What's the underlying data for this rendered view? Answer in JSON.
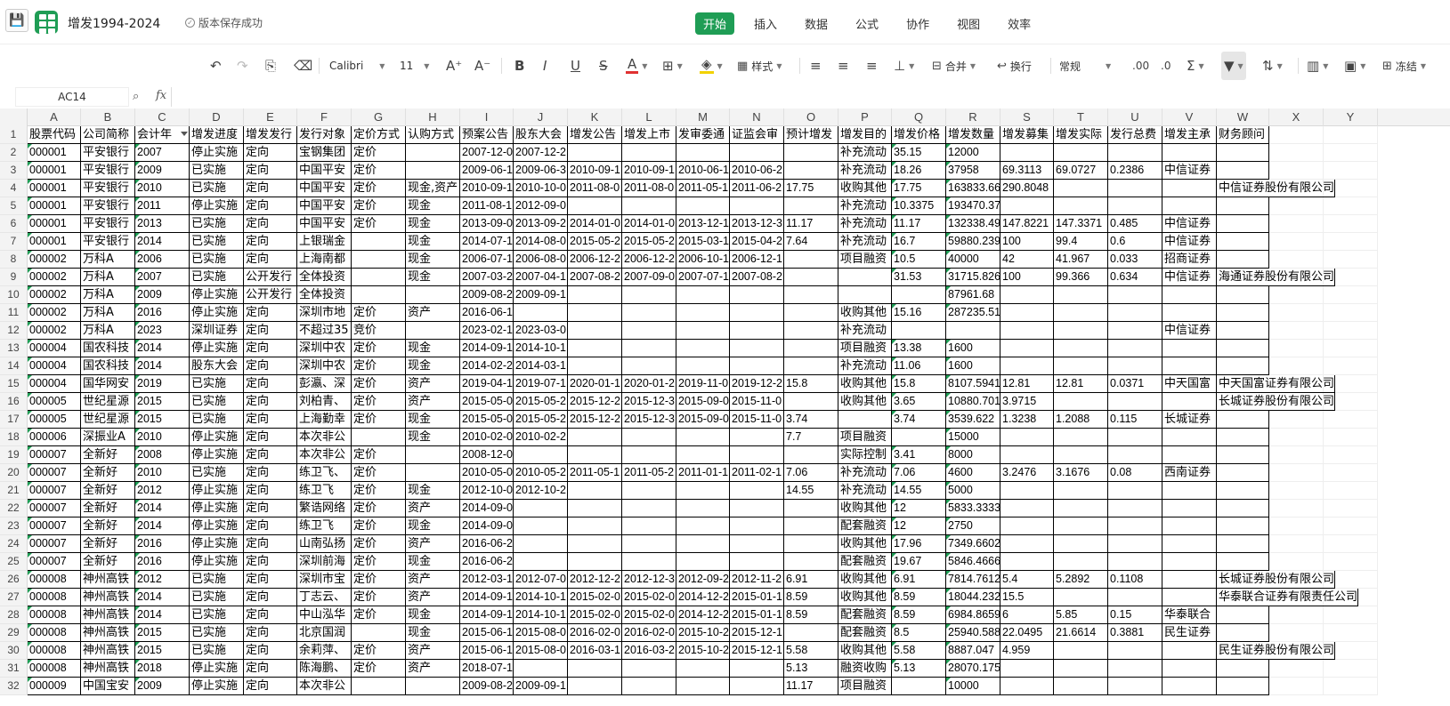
{
  "app": {
    "doc_title": "增发1994-2024",
    "save_status": "版本保存成功",
    "menu_tabs": [
      {
        "label": "开始",
        "active": true
      },
      {
        "label": "插入",
        "active": false
      },
      {
        "label": "数据",
        "active": false
      },
      {
        "label": "公式",
        "active": false
      },
      {
        "label": "协作",
        "active": false
      },
      {
        "label": "视图",
        "active": false
      },
      {
        "label": "效率",
        "active": false
      }
    ],
    "accent_color": "#1f9d55"
  },
  "toolbar": {
    "font_name": "Calibri",
    "font_size": "11",
    "style_label": "样式",
    "merge_label": "合并",
    "wrap_label": "换行",
    "number_format": "常规",
    "freeze_label": "冻结"
  },
  "formula_bar": {
    "name_box": "AC14",
    "fx": "fx",
    "formula": ""
  },
  "sheet": {
    "columns": [
      "A",
      "B",
      "C",
      "D",
      "E",
      "F",
      "G",
      "H",
      "I",
      "J",
      "K",
      "L",
      "M",
      "N",
      "O",
      "P",
      "Q",
      "R",
      "S",
      "T",
      "U",
      "V",
      "W",
      "X",
      "Y"
    ],
    "row_numbers": [
      "1",
      "2",
      "3",
      "4",
      "5",
      "6",
      "7",
      "8",
      "9",
      "10",
      "11",
      "12",
      "13",
      "14",
      "15",
      "16",
      "17",
      "18",
      "19",
      "20",
      "21",
      "22",
      "23",
      "24",
      "25",
      "26",
      "27",
      "28",
      "29",
      "30",
      "31",
      "32"
    ],
    "header": [
      "股票代码",
      "公司简称",
      "会计年",
      "增发进度",
      "增发发行",
      "发行对象",
      "定价方式",
      "认购方式",
      "预案公告",
      "股东大会",
      "增发公告",
      "增发上市",
      "发审委通",
      "证监会审",
      "预计增发",
      "增发目的",
      "增发价格",
      "增发数量",
      "增发募集",
      "增发实际",
      "发行总费",
      "增发主承",
      "财务顾问"
    ],
    "rows": [
      [
        "000001",
        "平安银行",
        "2007",
        "停止实施",
        "定向",
        "宝钢集团",
        "定价",
        "",
        "2007-12-0",
        "2007-12-2",
        "",
        "",
        "",
        "",
        "",
        "补充流动",
        "35.15",
        "12000",
        "",
        "",
        "",
        "",
        ""
      ],
      [
        "000001",
        "平安银行",
        "2009",
        "已实施",
        "定向",
        "中国平安",
        "定价",
        "",
        "2009-06-1",
        "2009-06-3",
        "2010-09-1",
        "2010-09-1",
        "2010-06-1",
        "2010-06-2",
        "",
        "补充流动",
        "18.26",
        "37958",
        "69.3113",
        "69.0727",
        "0.2386",
        "中信证券",
        ""
      ],
      [
        "000001",
        "平安银行",
        "2010",
        "已实施",
        "定向",
        "中国平安",
        "定价",
        "现金,资产",
        "2010-09-1",
        "2010-10-0",
        "2011-08-0",
        "2011-08-0",
        "2011-05-1",
        "2011-06-2",
        "17.75",
        "收购其他",
        "17.75",
        "163833.66",
        "290.8048",
        "",
        "",
        "",
        "中信证券股份有限公司"
      ],
      [
        "000001",
        "平安银行",
        "2011",
        "停止实施",
        "定向",
        "中国平安",
        "定价",
        "现金",
        "2011-08-1",
        "2012-09-0",
        "",
        "",
        "",
        "",
        "",
        "补充流动",
        "10.3375",
        "193470.37",
        "",
        "",
        "",
        "",
        ""
      ],
      [
        "000001",
        "平安银行",
        "2013",
        "已实施",
        "定向",
        "中国平安",
        "定价",
        "现金",
        "2013-09-0",
        "2013-09-2",
        "2014-01-0",
        "2014-01-0",
        "2013-12-1",
        "2013-12-3",
        "11.17",
        "补充流动",
        "11.17",
        "132338.49",
        "147.8221",
        "147.3371",
        "0.485",
        "中信证券",
        ""
      ],
      [
        "000001",
        "平安银行",
        "2014",
        "已实施",
        "定向",
        "上银瑞金",
        "",
        "现金",
        "2014-07-1",
        "2014-08-0",
        "2015-05-2",
        "2015-05-2",
        "2015-03-1",
        "2015-04-2",
        "7.64",
        "补充流动",
        "16.7",
        "59880.239",
        "100",
        "99.4",
        "0.6",
        "中信证券",
        ""
      ],
      [
        "000002",
        "万科A",
        "2006",
        "已实施",
        "定向",
        "上海南都",
        "",
        "现金",
        "2006-07-1",
        "2006-08-0",
        "2006-12-2",
        "2006-12-2",
        "2006-10-1",
        "2006-12-1",
        "",
        "项目融资",
        "10.5",
        "40000",
        "42",
        "41.967",
        "0.033",
        "招商证券",
        ""
      ],
      [
        "000002",
        "万科A",
        "2007",
        "已实施",
        "公开发行",
        "全体投资",
        "",
        "现金",
        "2007-03-2",
        "2007-04-1",
        "2007-08-2",
        "2007-09-0",
        "2007-07-1",
        "2007-08-2",
        "",
        "",
        "31.53",
        "31715.826",
        "100",
        "99.366",
        "0.634",
        "中信证券",
        "海通证券股份有限公司"
      ],
      [
        "000002",
        "万科A",
        "2009",
        "停止实施",
        "公开发行",
        "全体投资",
        "",
        "",
        "2009-08-2",
        "2009-09-1",
        "",
        "",
        "",
        "",
        "",
        "",
        "",
        "87961.68",
        "",
        "",
        "",
        "",
        ""
      ],
      [
        "000002",
        "万科A",
        "2016",
        "停止实施",
        "定向",
        "深圳市地",
        "定价",
        "资产",
        "2016-06-1",
        "",
        "",
        "",
        "",
        "",
        "",
        "收购其他",
        "15.16",
        "287235.51",
        "",
        "",
        "",
        "",
        ""
      ],
      [
        "000002",
        "万科A",
        "2023",
        "深圳证券",
        "定向",
        "不超过35",
        "竞价",
        "",
        "2023-02-1",
        "2023-03-0",
        "",
        "",
        "",
        "",
        "",
        "补充流动",
        "",
        "",
        "",
        "",
        "",
        "中信证券",
        ""
      ],
      [
        "000004",
        "国农科技",
        "2014",
        "停止实施",
        "定向",
        "深圳中农",
        "定价",
        "现金",
        "2014-09-1",
        "2014-10-1",
        "",
        "",
        "",
        "",
        "",
        "项目融资",
        "13.38",
        "1600",
        "",
        "",
        "",
        "",
        ""
      ],
      [
        "000004",
        "国农科技",
        "2014",
        "股东大会",
        "定向",
        "深圳中农",
        "定价",
        "现金",
        "2014-02-2",
        "2014-03-1",
        "",
        "",
        "",
        "",
        "",
        "补充流动",
        "11.06",
        "1600",
        "",
        "",
        "",
        "",
        ""
      ],
      [
        "000004",
        "国华网安",
        "2019",
        "已实施",
        "定向",
        "彭瀛、深",
        "定价",
        "资产",
        "2019-04-1",
        "2019-07-1",
        "2020-01-1",
        "2020-01-2",
        "2019-11-0",
        "2019-12-2",
        "15.8",
        "收购其他",
        "15.8",
        "8107.5941",
        "12.81",
        "12.81",
        "0.0371",
        "中天国富",
        "中天国富证券有限公司"
      ],
      [
        "000005",
        "世纪星源",
        "2015",
        "已实施",
        "定向",
        "刘柏青、",
        "定价",
        "资产",
        "2015-05-0",
        "2015-05-2",
        "2015-12-2",
        "2015-12-3",
        "2015-09-0",
        "2015-11-0",
        "",
        "收购其他",
        "3.65",
        "10880.701",
        "3.9715",
        "",
        "",
        "",
        "长城证券股份有限公司"
      ],
      [
        "000005",
        "世纪星源",
        "2015",
        "已实施",
        "定向",
        "上海勤幸",
        "定价",
        "现金",
        "2015-05-0",
        "2015-05-2",
        "2015-12-2",
        "2015-12-3",
        "2015-09-0",
        "2015-11-0",
        "3.74",
        "",
        "3.74",
        "3539.622",
        "1.3238",
        "1.2088",
        "0.115",
        "长城证券",
        ""
      ],
      [
        "000006",
        "深振业A",
        "2010",
        "停止实施",
        "定向",
        "本次非公",
        "",
        "现金",
        "2010-02-0",
        "2010-02-2",
        "",
        "",
        "",
        "",
        "7.7",
        "项目融资",
        "",
        "15000",
        "",
        "",
        "",
        "",
        ""
      ],
      [
        "000007",
        "全新好",
        "2008",
        "停止实施",
        "定向",
        "本次非公",
        "定价",
        "",
        "2008-12-0",
        "",
        "",
        "",
        "",
        "",
        "",
        "实际控制",
        "3.41",
        "8000",
        "",
        "",
        "",
        "",
        ""
      ],
      [
        "000007",
        "全新好",
        "2010",
        "已实施",
        "定向",
        "练卫飞、",
        "定价",
        "",
        "2010-05-0",
        "2010-05-2",
        "2011-05-1",
        "2011-05-2",
        "2011-01-1",
        "2011-02-1",
        "7.06",
        "补充流动",
        "7.06",
        "4600",
        "3.2476",
        "3.1676",
        "0.08",
        "西南证券",
        ""
      ],
      [
        "000007",
        "全新好",
        "2012",
        "停止实施",
        "定向",
        "练卫飞",
        "定价",
        "现金",
        "2012-10-0",
        "2012-10-2",
        "",
        "",
        "",
        "",
        "14.55",
        "补充流动",
        "14.55",
        "5000",
        "",
        "",
        "",
        "",
        ""
      ],
      [
        "000007",
        "全新好",
        "2014",
        "停止实施",
        "定向",
        "繁诰网络",
        "定价",
        "资产",
        "2014-09-0",
        "",
        "",
        "",
        "",
        "",
        "",
        "收购其他",
        "12",
        "5833.3333",
        "",
        "",
        "",
        "",
        ""
      ],
      [
        "000007",
        "全新好",
        "2014",
        "停止实施",
        "定向",
        "练卫飞",
        "定价",
        "现金",
        "2014-09-0",
        "",
        "",
        "",
        "",
        "",
        "",
        "配套融资",
        "12",
        "2750",
        "",
        "",
        "",
        "",
        ""
      ],
      [
        "000007",
        "全新好",
        "2016",
        "停止实施",
        "定向",
        "山南弘扬",
        "定价",
        "资产",
        "2016-06-2",
        "",
        "",
        "",
        "",
        "",
        "",
        "收购其他",
        "17.96",
        "7349.6602",
        "",
        "",
        "",
        "",
        ""
      ],
      [
        "000007",
        "全新好",
        "2016",
        "停止实施",
        "定向",
        "深圳前海",
        "定价",
        "现金",
        "2016-06-2",
        "",
        "",
        "",
        "",
        "",
        "",
        "配套融资",
        "19.67",
        "5846.4666",
        "",
        "",
        "",
        "",
        ""
      ],
      [
        "000008",
        "神州高铁",
        "2012",
        "已实施",
        "定向",
        "深圳市宝",
        "定价",
        "资产",
        "2012-03-1",
        "2012-07-0",
        "2012-12-2",
        "2012-12-3",
        "2012-09-2",
        "2012-11-2",
        "6.91",
        "收购其他",
        "6.91",
        "7814.7612",
        "5.4",
        "5.2892",
        "0.1108",
        "",
        "长城证券股份有限公司"
      ],
      [
        "000008",
        "神州高铁",
        "2014",
        "已实施",
        "定向",
        "丁志云、",
        "定价",
        "资产",
        "2014-09-1",
        "2014-10-1",
        "2015-02-0",
        "2015-02-0",
        "2014-12-2",
        "2015-01-1",
        "8.59",
        "收购其他",
        "8.59",
        "18044.232",
        "15.5",
        "",
        "",
        "",
        "华泰联合证券有限责任公司"
      ],
      [
        "000008",
        "神州高铁",
        "2014",
        "已实施",
        "定向",
        "中山泓华",
        "定价",
        "现金",
        "2014-09-1",
        "2014-10-1",
        "2015-02-0",
        "2015-02-0",
        "2014-12-2",
        "2015-01-1",
        "8.59",
        "配套融资",
        "8.59",
        "6984.8659",
        "6",
        "5.85",
        "0.15",
        "华泰联合",
        ""
      ],
      [
        "000008",
        "神州高铁",
        "2015",
        "已实施",
        "定向",
        "北京国润",
        "",
        "现金",
        "2015-06-1",
        "2015-08-0",
        "2016-02-0",
        "2016-02-0",
        "2015-10-2",
        "2015-12-1",
        "",
        "配套融资",
        "8.5",
        "25940.588",
        "22.0495",
        "21.6614",
        "0.3881",
        "民生证券",
        ""
      ],
      [
        "000008",
        "神州高铁",
        "2015",
        "已实施",
        "定向",
        "余莉萍、",
        "定价",
        "资产",
        "2015-06-1",
        "2015-08-0",
        "2016-03-1",
        "2016-03-2",
        "2015-10-2",
        "2015-12-1",
        "5.58",
        "收购其他",
        "5.58",
        "8887.047",
        "4.959",
        "",
        "",
        "",
        "民生证券股份有限公司"
      ],
      [
        "000008",
        "神州高铁",
        "2018",
        "停止实施",
        "定向",
        "陈海鹏、",
        "定价",
        "资产",
        "2018-07-1",
        "",
        "",
        "",
        "",
        "",
        "5.13",
        "融资收购",
        "5.13",
        "28070.175",
        "",
        "",
        "",
        "",
        ""
      ],
      [
        "000009",
        "中国宝安",
        "2009",
        "停止实施",
        "定向",
        "本次非公",
        "",
        "",
        "2009-08-2",
        "2009-09-1",
        "",
        "",
        "",
        "",
        "11.17",
        "项目融资",
        "",
        "10000",
        "",
        "",
        "",
        "",
        ""
      ]
    ]
  }
}
